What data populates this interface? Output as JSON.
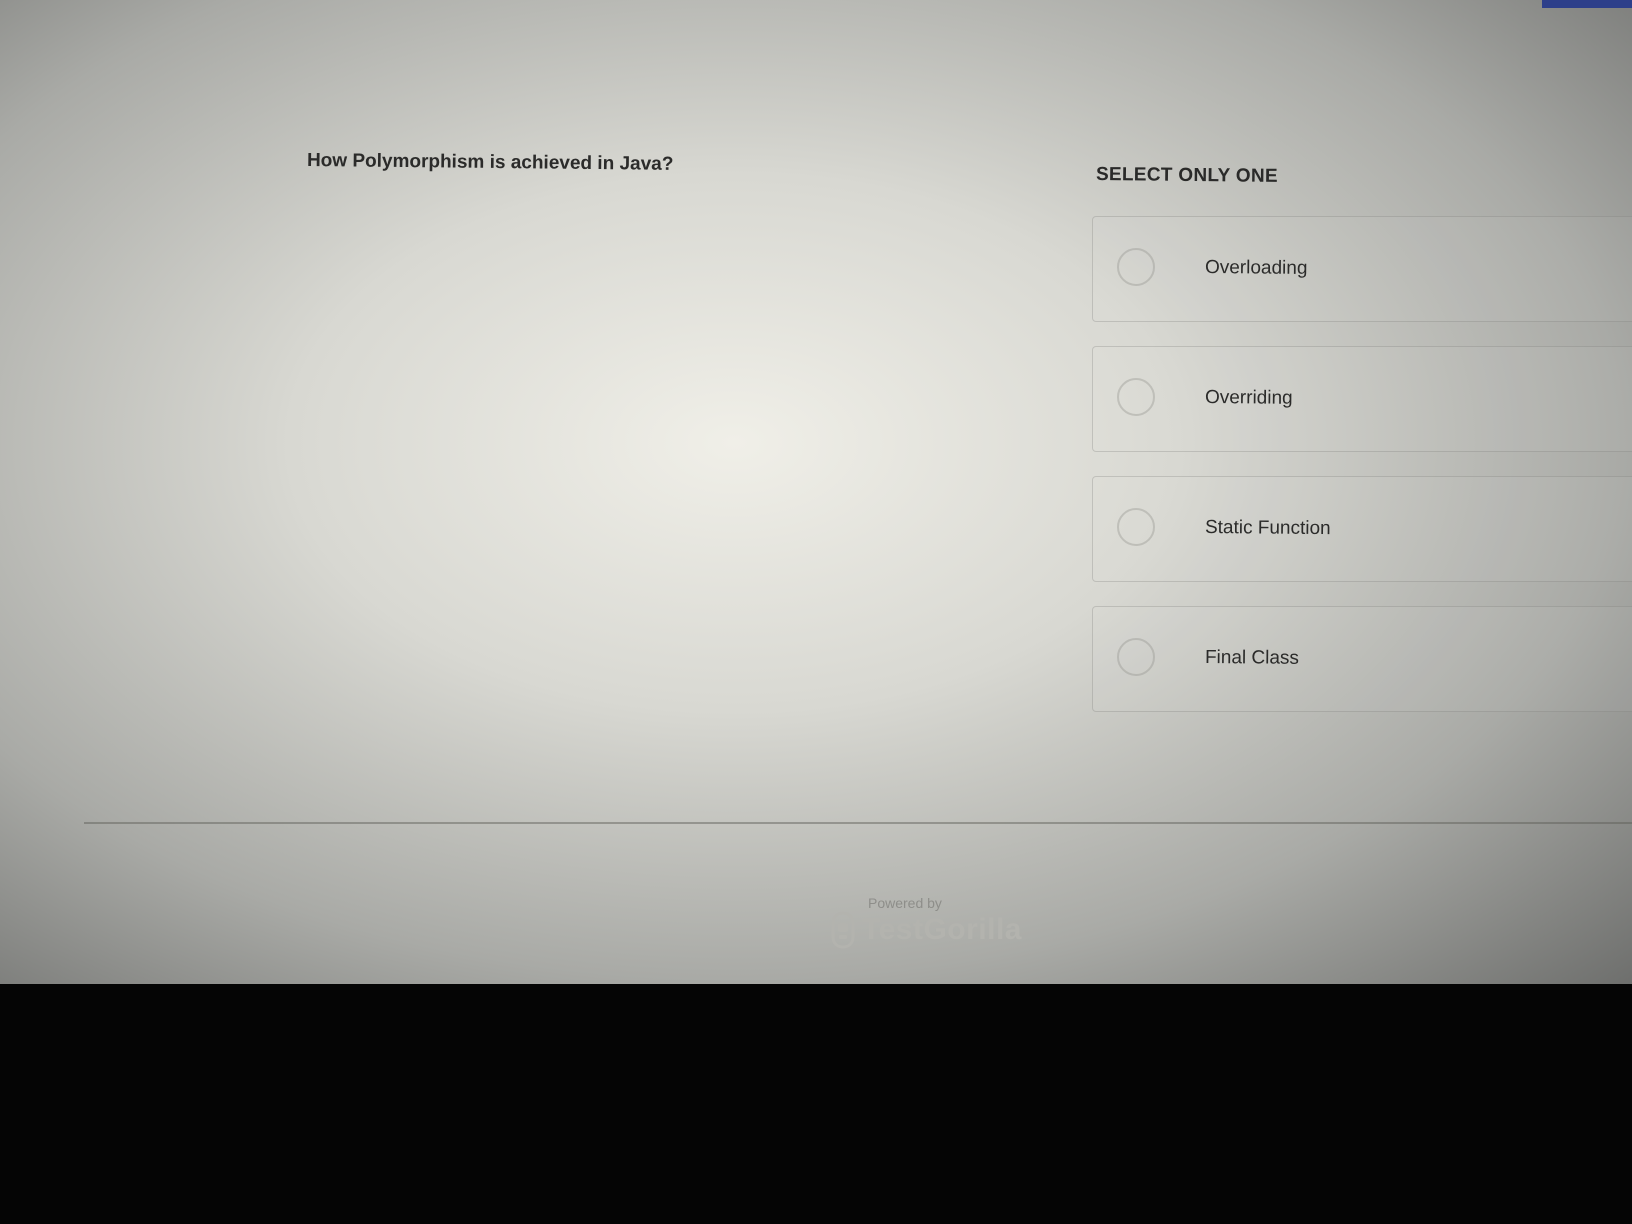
{
  "question": {
    "text": "How Polymorphism is achieved in Java?"
  },
  "answers": {
    "instruction": "SELECT ONLY ONE",
    "options": [
      {
        "label": "Overloading",
        "selected": false
      },
      {
        "label": "Overriding",
        "selected": false
      },
      {
        "label": "Static Function",
        "selected": false
      },
      {
        "label": "Final Class",
        "selected": false
      }
    ]
  },
  "footer": {
    "powered_by": "Powered by",
    "brand": "TestGorilla",
    "icon": "gorilla-logo-icon"
  },
  "colors": {
    "accent": "#2d3f8a",
    "text": "#2b2b2a"
  }
}
